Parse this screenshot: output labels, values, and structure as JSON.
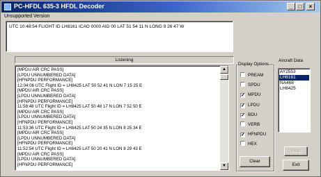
{
  "window": {
    "title": "PC-HFDL 635-3 HFDL Decoder",
    "subtitle": "Unsupported Version",
    "controls": [
      "_",
      "□",
      "×"
    ]
  },
  "current_message": "UTC 10:48:54  FLIGHT ID LH8161  ICAO 0000  AID 00  LAT 51 54 11   N   LONG 9 26 47   W",
  "status": "Listening",
  "log": [
    "[MPDU AIR CRC PASS]",
    "[LPDU UNNUMBERED DATA]",
    "[HFNPDU PERFORMANCE]",
    "12:04:06  UTC  Flight ID = LH8425  LAT 50 52 41   N   LON 7 15 25   E",
    "[MPDU AIR CRC PASS]",
    "[LPDU UNNUMBERED DATA]",
    "[HFNPDU PERFORMANCE]",
    "11:58:48  UTC  Flight ID = LH8425  LAT 50 48 17   N   LON 7 52 50   E",
    "[MPDU AIR CRC PASS]",
    "[LPDU UNNUMBERED DATA]",
    "[HFNPDU PERFORMANCE]",
    "11:53:36  UTC  Flight ID = LH8425  LAT 50 24 35   N   LON 8 25 34   E",
    "[MPDU AIR CRC PASS]",
    "[LPDU UNNUMBERED DATA]",
    "[HFNPDU PERFORMANCE]",
    "11:52:54  UTC  Flight ID = LH8425  LAT 50 20 41   N   LON 8 29 43   E",
    "[MPDU AIR CRC PASS]",
    "[LPDU UNNUMBERED DATA]",
    "[HFNPDU PERFORMANCE]"
  ],
  "display_options": {
    "label": "Display Options",
    "items": [
      {
        "label": "PREAM",
        "checked": false
      },
      {
        "label": "SPDU",
        "checked": false
      },
      {
        "label": "MPDU",
        "checked": true
      },
      {
        "label": "LPDU",
        "checked": true
      },
      {
        "label": "BDU",
        "checked": true
      },
      {
        "label": "VERB",
        "checked": false
      },
      {
        "label": "HFNPDU",
        "checked": true
      },
      {
        "label": "HEX",
        "checked": false
      }
    ],
    "clear_label": "Clear"
  },
  "aircraft_data": {
    "label": "Aircraft Data",
    "items": [
      "AY2553",
      "LH8161",
      "NA468",
      "LH8425"
    ],
    "selected": 1,
    "help_label": "Help",
    "exit_label": "Exit"
  }
}
